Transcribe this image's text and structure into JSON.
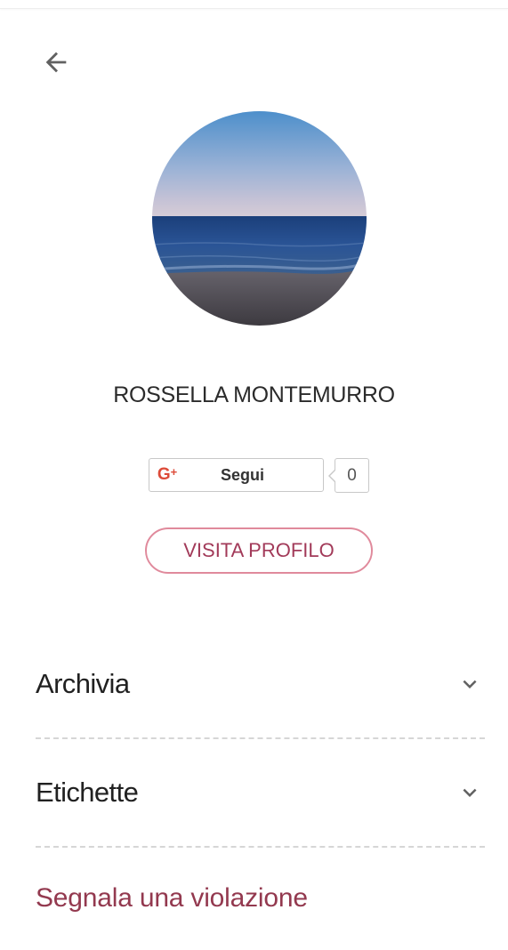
{
  "profile": {
    "name": "ROSSELLA MONTEMURRO"
  },
  "gplus": {
    "logo_text": "G+",
    "follow_label": "Segui",
    "count": "0",
    "brand_color": "#dd4b39"
  },
  "visit_profile_label": "VISITA PROFILO",
  "sections": [
    {
      "label": "Archivia"
    },
    {
      "label": "Etichette"
    }
  ],
  "report_link": "Segnala una violazione",
  "colors": {
    "accent": "#a23a59",
    "accent_border": "#e08a9c",
    "report": "#93394f"
  },
  "icons": {
    "back": "arrow-left-icon",
    "expand": "chevron-down-icon"
  }
}
